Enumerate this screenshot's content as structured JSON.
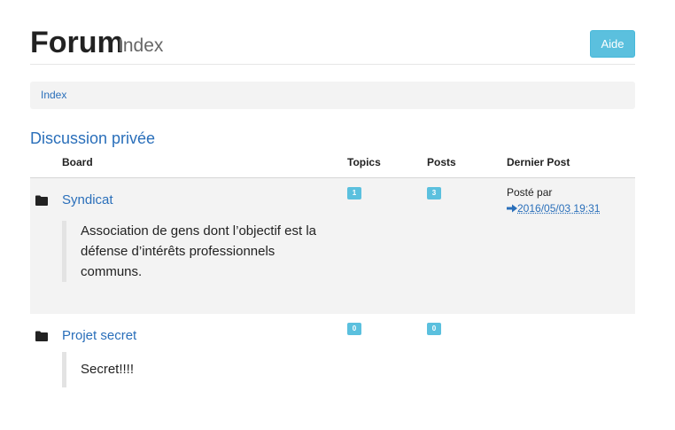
{
  "header": {
    "title": "Forum",
    "subtitle": "Index",
    "help_label": "Aide"
  },
  "breadcrumb": {
    "items": [
      "Index"
    ]
  },
  "category": {
    "title": "Discussion privée"
  },
  "columns": {
    "board": "Board",
    "topics": "Topics",
    "posts": "Posts",
    "last_post": "Dernier Post"
  },
  "boards": [
    {
      "name": "Syndicat",
      "description": "Association de gens dont l’objectif est la défense d’intérêts professionnels communs.",
      "topics": "1",
      "posts": "3",
      "last_post_label": "Posté par",
      "last_post_date": "2016/05/03 19:31"
    },
    {
      "name": "Projet secret",
      "description": "Secret!!!!",
      "topics": "0",
      "posts": "0"
    }
  ],
  "icons": {
    "folder": "folder-icon",
    "arrow": "arrow-right-icon"
  },
  "colors": {
    "link": "#2a6fba",
    "badge": "#5bc0de",
    "row_shade": "#f3f3f3"
  }
}
